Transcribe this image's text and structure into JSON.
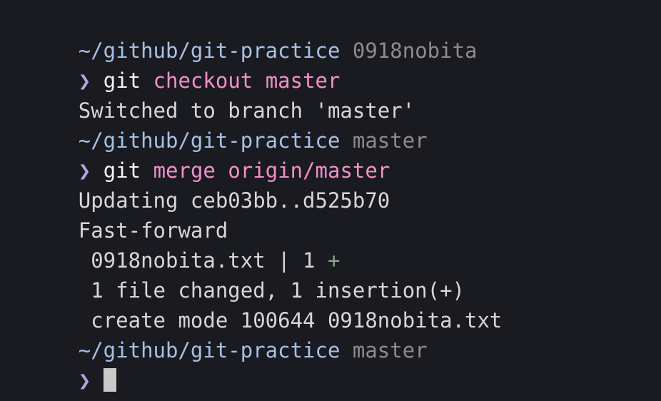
{
  "terminal": {
    "background_color": "#1a1b21",
    "colors": {
      "path": "#a6c0e3",
      "branch": "#8c8c8c",
      "prompt": "#b8a3e0",
      "command": "#f4f4f6",
      "argument": "#f28fc8",
      "output": "#d6d6da",
      "added": "#87a387",
      "cursor": "#c9c9c9"
    },
    "prompt_symbol": "❯",
    "lines": [
      {
        "id": "prompt-line-1",
        "type": "prompt",
        "path": "~/github/git-practice",
        "branch": "0918nobita"
      },
      {
        "id": "command-line-1",
        "type": "command",
        "command": "git",
        "args": "checkout master"
      },
      {
        "id": "output-line-1",
        "type": "output",
        "text": "Switched to branch 'master'"
      },
      {
        "id": "prompt-line-2",
        "type": "prompt",
        "path": "~/github/git-practice",
        "branch": "master"
      },
      {
        "id": "command-line-2",
        "type": "command",
        "command": "git",
        "args": "merge origin/master"
      },
      {
        "id": "output-line-2",
        "type": "output",
        "text": "Updating ceb03bb..d525b70"
      },
      {
        "id": "output-line-3",
        "type": "output",
        "text": "Fast-forward"
      },
      {
        "id": "diffstat-line",
        "type": "diffstat",
        "text": " 0918nobita.txt | 1 ",
        "added": "+"
      },
      {
        "id": "output-line-4",
        "type": "output",
        "text": " 1 file changed, 1 insertion(+)"
      },
      {
        "id": "output-line-5",
        "type": "output",
        "text": " create mode 100644 0918nobita.txt"
      },
      {
        "id": "prompt-line-3",
        "type": "prompt",
        "path": "~/github/git-practice",
        "branch": "master"
      },
      {
        "id": "active-input-line",
        "type": "input",
        "value": ""
      }
    ]
  }
}
